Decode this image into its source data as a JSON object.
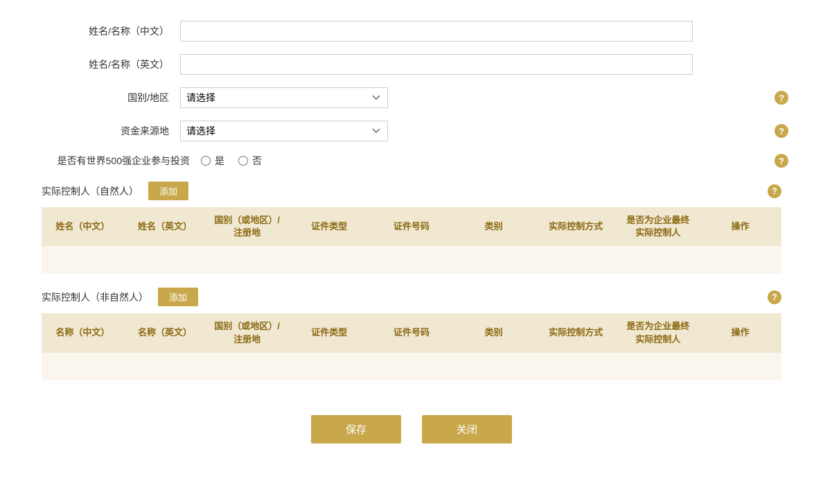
{
  "form": {
    "name_cn_label": "姓名/名称（中文）",
    "name_en_label": "姓名/名称（英文）",
    "country_label": "国别/地区",
    "fund_source_label": "资金来源地",
    "fortune500_label": "是否有世界500强企业参与投资",
    "please_select": "请选择",
    "yes_label": "是",
    "no_label": "否"
  },
  "natural_person_section": {
    "title": "实际控制人（自然人）",
    "add_label": "添加",
    "columns": [
      "姓名（中文）",
      "姓名（英文）",
      "国别（或地区）/注册地",
      "证件类型",
      "证件号码",
      "类别",
      "实际控制方式",
      "是否为企业最终实际控制人",
      "操作"
    ]
  },
  "non_natural_person_section": {
    "title": "实际控制人（非自然人）",
    "add_label": "添加",
    "columns": [
      "名称（中文）",
      "名称（英文）",
      "国别（或地区）/注册地",
      "证件类型",
      "证件号码",
      "类别",
      "实际控制方式",
      "是否为企业最终实际控制人",
      "操作"
    ]
  },
  "actions": {
    "save_label": "保存",
    "close_label": "关闭"
  },
  "help_icon": "?",
  "col_widths": [
    "11%",
    "11%",
    "13%",
    "10%",
    "10%",
    "8%",
    "12%",
    "13%",
    "8%"
  ]
}
